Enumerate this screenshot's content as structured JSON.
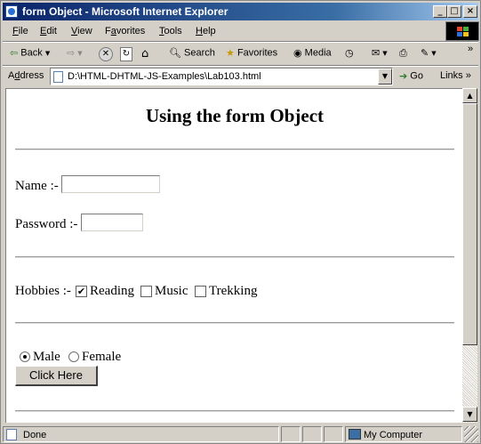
{
  "window": {
    "title": "form Object - Microsoft Internet Explorer",
    "minimize": "_",
    "maximize": "□",
    "close": "×"
  },
  "menu": {
    "file": {
      "key": "F",
      "rest": "ile"
    },
    "edit": {
      "key": "E",
      "rest": "dit"
    },
    "view": {
      "key": "V",
      "rest": "iew"
    },
    "favorites": {
      "key": "a",
      "pre": "F",
      "rest": "vorites"
    },
    "tools": {
      "key": "T",
      "rest": "ools"
    },
    "help": {
      "key": "H",
      "rest": "elp"
    }
  },
  "toolbar": {
    "back": "Back",
    "search": "Search",
    "favorites": "Favorites",
    "media": "Media",
    "overflow": "»"
  },
  "address": {
    "label_key": "d",
    "label_pre": "A",
    "label_rest": "dress",
    "url": "D:\\HTML-DHTML-JS-Examples\\Lab103.html",
    "go": "Go",
    "links": "Links",
    "links_overflow": "»"
  },
  "page": {
    "heading": "Using the form Object",
    "name_label": "Name :-",
    "name_value": "",
    "password_label": "Password :-",
    "password_value": "",
    "hobbies_label": "Hobbies :-",
    "hobbies": [
      {
        "label": "Reading",
        "checked": true
      },
      {
        "label": "Music",
        "checked": false
      },
      {
        "label": "Trekking",
        "checked": false
      }
    ],
    "gender": [
      {
        "label": "Male",
        "selected": true
      },
      {
        "label": "Female",
        "selected": false
      }
    ],
    "button": "Click Here"
  },
  "status": {
    "text": "Done",
    "zone": "My Computer"
  }
}
